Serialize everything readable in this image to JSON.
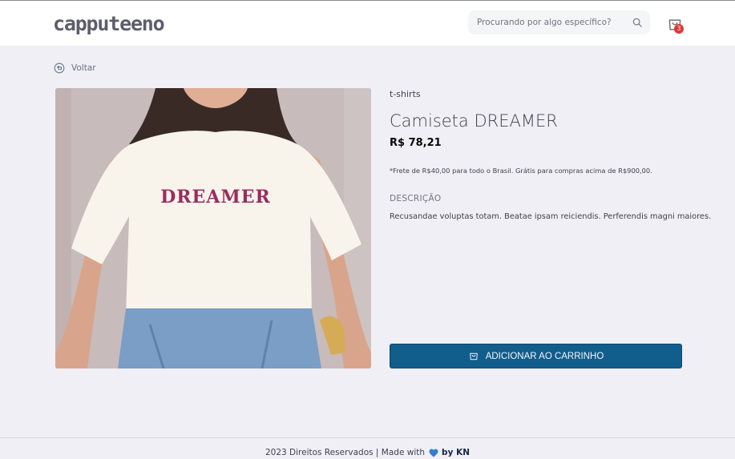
{
  "header": {
    "logo": "capputeeno",
    "search": {
      "placeholder": "Procurando por algo específico?",
      "icon": "search-icon"
    },
    "cart": {
      "icon": "shopping-bag-icon",
      "count": "3",
      "badge_color": "#de3838"
    }
  },
  "nav": {
    "back_label": "Voltar",
    "back_icon": "back-arrow-icon"
  },
  "product": {
    "category": "t-shirts",
    "name": "Camiseta DREAMER",
    "price": "R$ 78,21",
    "shipping_note": "*Frete de R$40,00 para todo o Brasil. Grátis para compras acima de R$900,00.",
    "description_heading": "DESCRIÇÃO",
    "description": "Recusandae voluptas totam. Beatae ipsam reiciendis. Perferendis magni maiores.",
    "shirt_print": "DREAMER"
  },
  "actions": {
    "add_to_cart_label": "ADICIONAR AO CARRINHO",
    "button_color": "#115d8c"
  },
  "footer": {
    "text": "2023 Direitos Reservados | Made with",
    "credit": "by KN",
    "heart_color": "#2f7fd1"
  }
}
